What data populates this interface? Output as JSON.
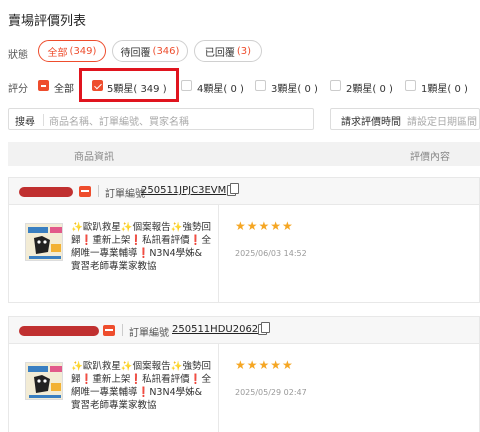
{
  "page": {
    "title": "賣場評價列表"
  },
  "status_filter": {
    "label": "狀態",
    "pills": [
      {
        "label": "全部",
        "count": "(349)",
        "active": true
      },
      {
        "label": "待回覆",
        "count": "(346)",
        "active": false
      },
      {
        "label": "已回覆",
        "count": "(3)",
        "active": false
      }
    ]
  },
  "rating_filter": {
    "label": "評分",
    "options": [
      {
        "label": "全部"
      },
      {
        "label": "5顆星( 349 )"
      },
      {
        "label": "4顆星( 0 )"
      },
      {
        "label": "3顆星( 0 )"
      },
      {
        "label": "2顆星( 0 )"
      },
      {
        "label": "1顆星( 0 )"
      }
    ]
  },
  "search": {
    "label": "搜尋",
    "placeholder": "商品名稱、訂單編號、買家名稱"
  },
  "date_search": {
    "label": "請求評價時間",
    "placeholder": "請設定日期區間"
  },
  "table": {
    "col_product": "商品資訊",
    "col_review": "評價內容"
  },
  "orders": [
    {
      "order_label": "訂單編號",
      "order_no": "250511JPJC3EVM",
      "product_name": "✨歐趴救星✨個案報告✨強勢回歸❗重新上架❗私訊看評價❗全網唯一專業輔導❗N3N4學姊&實習老師專業家教協",
      "stars": "★★★★★",
      "date": "2025/06/03 14:52"
    },
    {
      "order_label": "訂單編號",
      "order_no": "250511HDU2062X",
      "product_name": "✨歐趴救星✨個案報告✨強勢回歸❗重新上架❗私訊看評價❗全網唯一專業輔導❗N3N4學姊&實習老師專業家教協",
      "stars": "★★★★★",
      "date": "2025/05/29 02:47"
    }
  ],
  "colors": {
    "accent": "#ee4d2d",
    "star": "#f5a623",
    "highlight": "#e0141e"
  }
}
